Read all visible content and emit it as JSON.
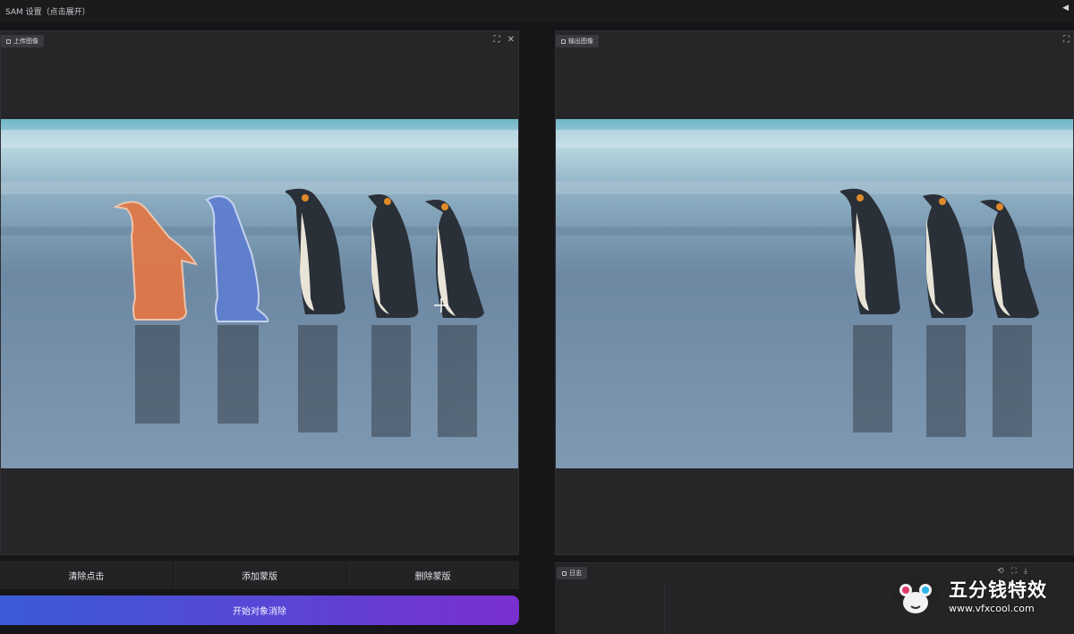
{
  "topbar": {
    "title": "SAM 设置（点击展开）",
    "collapse_icon": "◀"
  },
  "input_panel": {
    "label": "上传图像",
    "tools": [
      "⛶",
      "✕"
    ]
  },
  "output_panel": {
    "label": "输出图像",
    "tools": [
      "⛶"
    ]
  },
  "actions": {
    "clear_points": "清除点击",
    "add_mask": "添加蒙版",
    "delete_mask": "删除蒙版",
    "start_removal": "开始对象消除"
  },
  "result_panel": {
    "label": "日志",
    "tools": [
      "⟲",
      "⛶",
      "⤓"
    ]
  },
  "watermark": {
    "title": "五分钱特效",
    "url": "www.vfxcool.com"
  },
  "colors": {
    "mask_orange": "#e07848",
    "mask_blue": "#5f7fd0",
    "accent_start": "#3b5bd8",
    "accent_end": "#7b2fd0"
  },
  "icons": {
    "cursor": "crosshair-icon",
    "fullscreen": "fullscreen-icon",
    "close": "close-icon"
  }
}
